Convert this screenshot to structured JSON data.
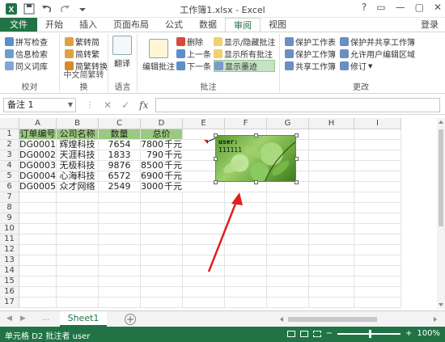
{
  "window": {
    "title": "工作簿1.xlsx - Excel",
    "controls": [
      "?",
      "▭",
      "—",
      "▢",
      "✕"
    ]
  },
  "tabs": {
    "file": "文件",
    "items": [
      "开始",
      "插入",
      "页面布局",
      "公式",
      "数据",
      "审阅",
      "视图"
    ],
    "active": "审阅",
    "login": "登录"
  },
  "ribbon": {
    "proofing": {
      "spell": "拼写检查",
      "research": "信息检索",
      "thesaurus": "同义词库",
      "label": "校对"
    },
    "chinese": {
      "to_trad": "繁转简",
      "to_simp": "简转繁",
      "convert": "简繁转换",
      "label": "中文简繁转换"
    },
    "language": {
      "translate": "翻译",
      "label": "语言"
    },
    "comments": {
      "edit": "编辑批注",
      "delete": "删除",
      "prev": "上一条",
      "next": "下一条",
      "show_hide": "显示/隐藏批注",
      "show_all": "显示所有批注",
      "show_ink": "显示墨迹",
      "label": "批注"
    },
    "changes": {
      "protect_sheet": "保护工作表",
      "protect_book": "保护工作簿",
      "share_book": "共享工作簿",
      "protect_share": "保护并共享工作簿",
      "allow_edit": "允许用户编辑区域",
      "track": "修订",
      "label": "更改"
    }
  },
  "formula_bar": {
    "name_box": "备注 1",
    "cancel": "✕",
    "enter": "✓",
    "fx": "fx",
    "value": ""
  },
  "grid": {
    "columns": [
      "A",
      "B",
      "C",
      "D",
      "E",
      "F",
      "G",
      "H",
      "I"
    ],
    "rows": [
      "1",
      "2",
      "3",
      "4",
      "5",
      "6",
      "7",
      "8",
      "9",
      "10",
      "11",
      "12",
      "13",
      "14",
      "15",
      "16",
      "17"
    ],
    "header": [
      "订单编号",
      "公司名称",
      "数量",
      "总价"
    ],
    "data": [
      [
        "DG0001",
        "辉煌科技",
        "7654",
        "7800",
        "千元"
      ],
      [
        "DG0002",
        "天涯科技",
        "1833",
        "790",
        "千元"
      ],
      [
        "DG0003",
        "无极科技",
        "9876",
        "8500",
        "千元"
      ],
      [
        "DG0004",
        "心海科技",
        "6572",
        "6900",
        "千元"
      ],
      [
        "DG0005",
        "众才网络",
        "2549",
        "3000",
        "千元"
      ]
    ]
  },
  "comment": {
    "author": "user:",
    "text": "111111"
  },
  "sheets": {
    "names": [
      "Sheet1"
    ],
    "more": "...",
    "add": "+"
  },
  "status": {
    "text": "单元格 D2 批注者 user",
    "zoom": "100%",
    "zoom_minus": "−",
    "zoom_plus": "+"
  },
  "colors": {
    "accent": "#217346",
    "header_fill": "#9bc97f",
    "annotation_arrow": "#e02020"
  }
}
